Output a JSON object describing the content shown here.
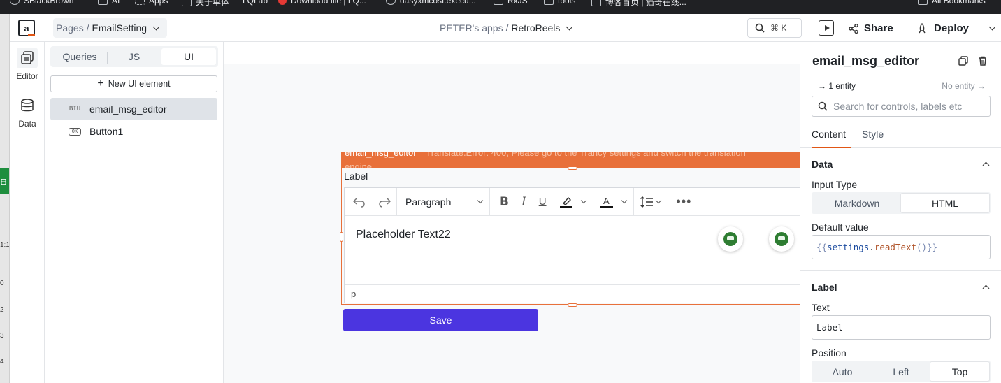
{
  "bookmarks": [
    {
      "label": "SBlackBrown",
      "icon": "globe-icon"
    },
    {
      "label": "AI",
      "icon": "folder-icon"
    },
    {
      "label": "Apps",
      "icon": "apps-grid-icon"
    },
    {
      "label": "关于单体",
      "icon": "page-icon"
    },
    {
      "label": "LQLab",
      "icon": "page-icon"
    },
    {
      "label": "Download file | LQ...",
      "icon": "red-dot-icon"
    },
    {
      "label": "dasyxmcosf.execu...",
      "icon": "globe-icon"
    },
    {
      "label": "RxJS",
      "icon": "folder-icon"
    },
    {
      "label": "tools",
      "icon": "folder-icon"
    },
    {
      "label": "博客首页 | 猫哥在线...",
      "icon": "page-icon"
    },
    {
      "label": "All Bookmarks",
      "icon": "folder-icon"
    }
  ],
  "header": {
    "pages_prefix": "Pages /",
    "page_name": "EmailSetting",
    "workspace": "PETER's apps /",
    "app_name": "RetroReels",
    "shortcut": "⌘ K",
    "share_label": "Share",
    "deploy_label": "Deploy"
  },
  "rail": {
    "editor_label": "Editor",
    "data_label": "Data"
  },
  "explorer": {
    "tabs": [
      "Queries",
      "JS",
      "UI"
    ],
    "active_tab": "UI",
    "new_button": "New UI element",
    "entities": [
      {
        "name": "email_msg_editor",
        "icon_text": "BIU",
        "selected": true
      },
      {
        "name": "Button1",
        "icon_text": "OK",
        "selected": false
      }
    ]
  },
  "canvas": {
    "widget_name": "email_msg_editor",
    "widget_error": "Translate.Error: 400, Please go to the Trancy settings and switch the translation",
    "widget_error_cont": "engine.",
    "label": "Label",
    "paragraph_select": "Paragraph",
    "editor_content": "Placeholder Text22",
    "status_path": "p",
    "save_button": "Save"
  },
  "pane": {
    "title": "email_msg_editor",
    "entity_link_left": "1 entity",
    "entity_link_right": "No entity",
    "search_placeholder": "Search for controls, labels etc",
    "tabs": [
      "Content",
      "Style"
    ],
    "active_tab": "Content",
    "data_section": "Data",
    "input_type_label": "Input Type",
    "input_type_options": [
      "Markdown",
      "HTML"
    ],
    "input_type_selected": "HTML",
    "default_value_label": "Default value",
    "default_value": "{{settings.readText()}}",
    "label_section": "Label",
    "text_label": "Text",
    "text_value": "Label",
    "position_label": "Position",
    "position_options": [
      "Auto",
      "Left",
      "Top"
    ],
    "position_selected": "Top"
  },
  "colors": {
    "accent": "#e15615",
    "widget_selection": "#e8703a",
    "save_button": "#4b35e0"
  }
}
